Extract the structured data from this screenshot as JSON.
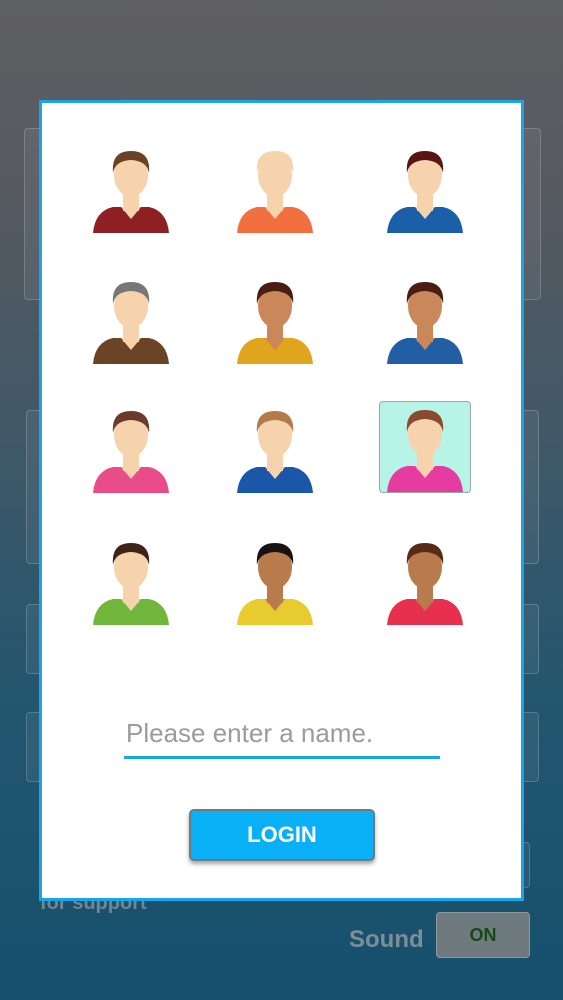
{
  "background": {
    "support_text": "for support",
    "sound_label": "Sound",
    "sound_toggle": "ON"
  },
  "avatars": [
    {
      "id": "avatar-1",
      "hair": "#6b4226",
      "skin": "#f6d3ad",
      "shirt": "#8e1f23",
      "selected": false
    },
    {
      "id": "avatar-2",
      "hair": "#f6d3ad",
      "skin": "#f6d3ad",
      "shirt": "#f26f40",
      "selected": false
    },
    {
      "id": "avatar-3",
      "hair": "#5a1414",
      "skin": "#f6d3ad",
      "shirt": "#1a5fa8",
      "selected": false
    },
    {
      "id": "avatar-4",
      "hair": "#777777",
      "skin": "#f6d3ad",
      "shirt": "#6b4426",
      "selected": false
    },
    {
      "id": "avatar-5",
      "hair": "#4a1d14",
      "skin": "#c9875a",
      "shirt": "#e0a41d",
      "selected": false
    },
    {
      "id": "avatar-6",
      "hair": "#4a1d14",
      "skin": "#c9875a",
      "shirt": "#225ea3",
      "selected": false
    },
    {
      "id": "avatar-7",
      "hair": "#6b3a2c",
      "skin": "#f6d3ad",
      "shirt": "#ea4c89",
      "selected": false
    },
    {
      "id": "avatar-8",
      "hair": "#b57a4a",
      "skin": "#f6d3ad",
      "shirt": "#1a57a8",
      "selected": false
    },
    {
      "id": "avatar-9",
      "hair": "#8a4a2e",
      "skin": "#f6d3ad",
      "shirt": "#e63ba0",
      "selected": true
    },
    {
      "id": "avatar-10",
      "hair": "#3e2318",
      "skin": "#f6d3ad",
      "shirt": "#6fb63b",
      "selected": false
    },
    {
      "id": "avatar-11",
      "hair": "#1a1212",
      "skin": "#b97a4c",
      "shirt": "#e8cb2f",
      "selected": false
    },
    {
      "id": "avatar-12",
      "hair": "#5a2a18",
      "skin": "#b97a4c",
      "shirt": "#e6304e",
      "selected": false
    }
  ],
  "name_input": {
    "value": "",
    "placeholder": "Please enter a name."
  },
  "login_label": "LOGIN",
  "colors": {
    "accent": "#17a7e8",
    "button": "#0ab0f5",
    "selected_bg": "#b8f3e7"
  }
}
